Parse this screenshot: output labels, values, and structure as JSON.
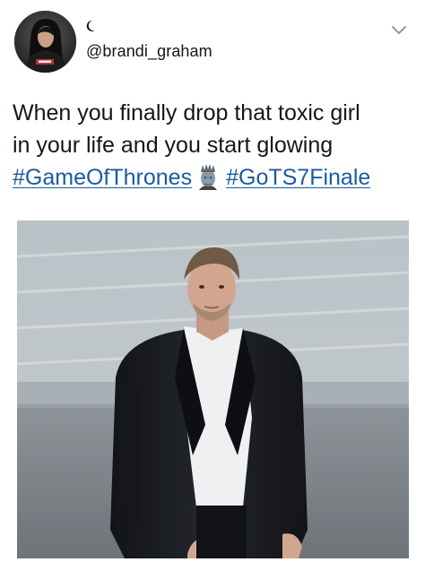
{
  "tweet": {
    "handle": "@brandi_graham",
    "text_line_1": "When you finally drop that toxic girl",
    "text_line_2": "in your life and you start glowing",
    "hashtag_1": "#GameOfThrones",
    "hashtag_2": "#GoTS7Finale"
  },
  "icons": {
    "status": "moon-icon",
    "menu": "chevron-down-icon",
    "hashtag_emoji": "night-king-emoji-icon"
  },
  "colors": {
    "hashtag": "#1b5b9e",
    "text": "#14171a"
  }
}
